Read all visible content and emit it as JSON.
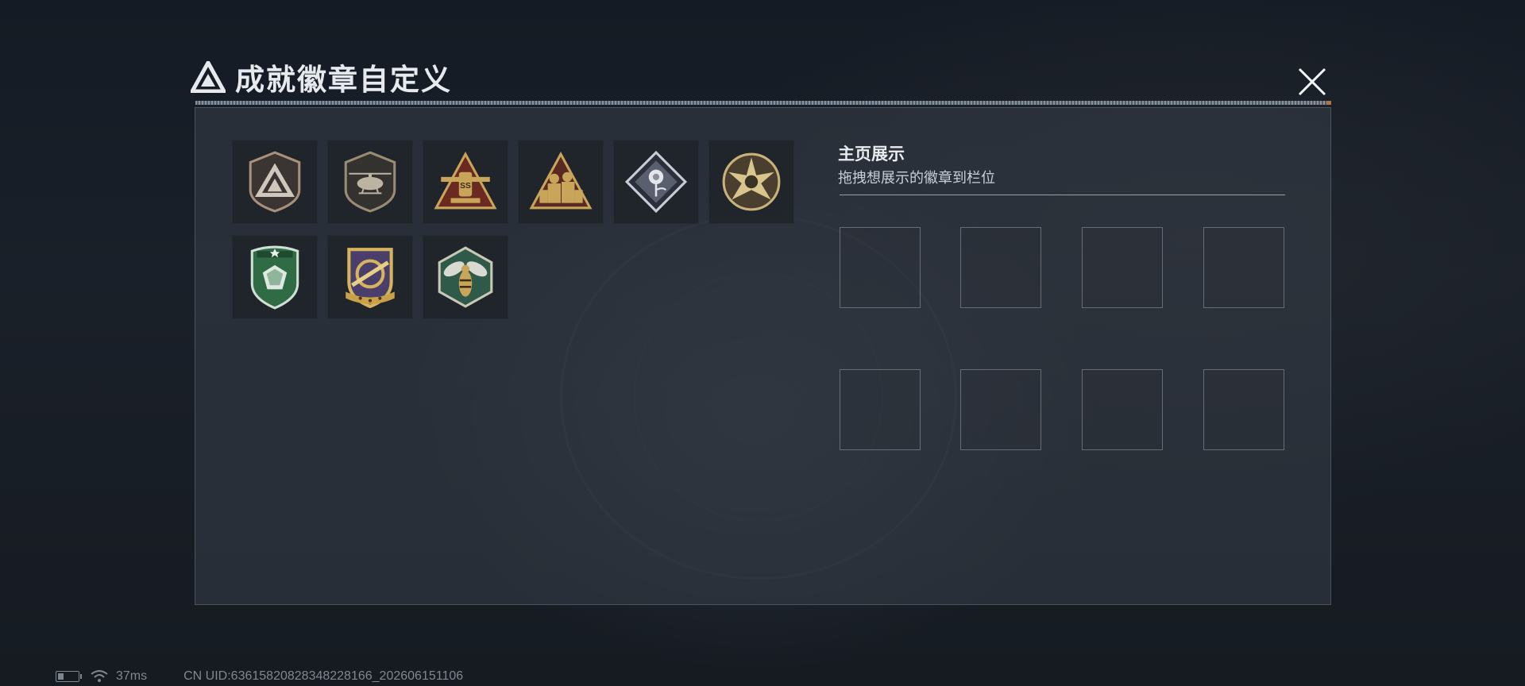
{
  "header": {
    "title": "成就徽章自定义",
    "logo_icon": "triangle-logo-icon",
    "close_icon": "close-icon"
  },
  "collection": {
    "badges": [
      {
        "name": "badge-triangle-shield",
        "icon": "triangle-shield-icon"
      },
      {
        "name": "badge-helicopter",
        "icon": "helicopter-icon"
      },
      {
        "name": "badge-ss-triangle",
        "icon": "ss-triangle-icon",
        "label": "SS"
      },
      {
        "name": "badge-soldiers-triangle",
        "icon": "soldiers-triangle-icon"
      },
      {
        "name": "badge-rose-diamond",
        "icon": "rose-diamond-icon"
      },
      {
        "name": "badge-star-circle",
        "icon": "star-circle-icon"
      },
      {
        "name": "badge-green-gem-shield",
        "icon": "green-gem-shield-icon"
      },
      {
        "name": "badge-gold-crest",
        "icon": "gold-crest-icon"
      },
      {
        "name": "badge-hornet-hexagon",
        "icon": "hornet-hexagon-icon"
      }
    ]
  },
  "display": {
    "title": "主页展示",
    "hint": "拖拽想展示的徽章到栏位",
    "slot_count": 8
  },
  "status": {
    "battery_icon": "battery-icon",
    "wifi_icon": "wifi-icon",
    "ping": "37ms",
    "uid": "CN UID:6361582082834822816​6_202606151106"
  },
  "colors": {
    "gold": "#c9a55a",
    "bronze": "#9a7a4a",
    "green": "#2f6b45",
    "panel": "#343a44",
    "text": "#e6e9ed"
  }
}
